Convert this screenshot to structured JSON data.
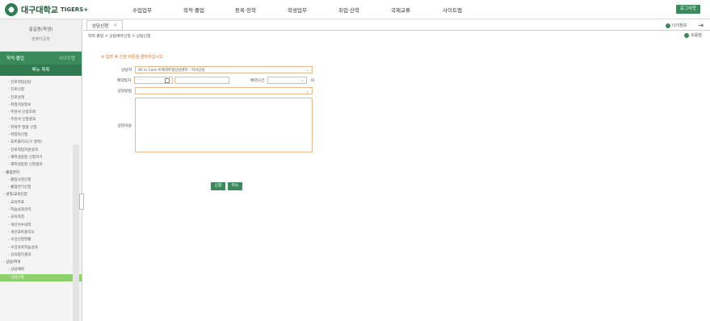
{
  "header": {
    "logo_text": "대구대학교",
    "logo_sub": "TIGERS+",
    "nav": [
      "수업업무",
      "학적·졸업",
      "등록·장학",
      "학생업무",
      "취업·산학",
      "국제교류",
      "사이트맵"
    ],
    "logout": "로그아웃"
  },
  "sidebar": {
    "profile_name": "홍길동(학생)",
    "profile_dept": "컴퓨터공학",
    "menu_head": "학적·졸업",
    "menu_head_right": "사이트맵",
    "menu_sub": "메뉴 목록",
    "items": [
      {
        "label": "- 진로취업상담",
        "group": false
      },
      {
        "label": "- 진로신청",
        "group": false
      },
      {
        "label": "- 진로설계",
        "group": false
      },
      {
        "label": "- 취업지원정보",
        "group": false
      },
      {
        "label": "- 추천서 신청조회",
        "group": false
      },
      {
        "label": "- 추천서 신청결과",
        "group": false
      },
      {
        "label": "- 학적부 열람 신청",
        "group": false
      },
      {
        "label": "- 취업자신청",
        "group": false
      },
      {
        "label": "- 포트폴리오(구 경력)",
        "group": false
      },
      {
        "label": "- 진로취업지원실적",
        "group": false
      },
      {
        "label": "- 재학생종합 신청하기",
        "group": false
      },
      {
        "label": "- 재학생종합 신청결과",
        "group": false
      },
      {
        "label": "- 졸업관리",
        "group": true
      },
      {
        "label": "- 졸업사정신청",
        "group": false
      },
      {
        "label": "- 졸업연기신청",
        "group": false
      },
      {
        "label": "- 성적/교육인증",
        "group": true
      },
      {
        "label": "- 교육목표",
        "group": false
      },
      {
        "label": "- 학습성과관리",
        "group": false
      },
      {
        "label": "- 교육과정",
        "group": false
      },
      {
        "label": "- 개인이수내역",
        "group": false
      },
      {
        "label": "- 개인포트폴리오",
        "group": false
      },
      {
        "label": "- 수강신청현황",
        "group": false
      },
      {
        "label": "- 수강과목학습성과",
        "group": false
      },
      {
        "label": "- 강의평가결과",
        "group": false
      },
      {
        "label": "- 상담/학적",
        "group": true
      },
      {
        "label": "- 상담예약",
        "group": false
      },
      {
        "label": "- 상담신청",
        "group": false
      }
    ],
    "active_index": 26
  },
  "main": {
    "tab_label": "상담신청",
    "top_right_label": "나의정보",
    "breadcrumb": "학적·졸업 > 상담예약신청 > 상담신청",
    "help_label": "도움말",
    "notice": "※ 입력 후 신청 버튼을 클릭하십시오.",
    "form": {
      "counselor_label": "상담처",
      "counselor_value": "All in Care 이해대학생상담센터 - 학사상담",
      "date_label": "예약일자",
      "date_placeholder": "- - -",
      "time_label": "예약시간",
      "time_unit": "시",
      "type_label": "상담방법",
      "content_label": "상담내용"
    },
    "buttons": {
      "apply": "신청",
      "cancel": "취소"
    }
  },
  "colors": {
    "accent": "#3a8a5c",
    "active_menu": "#8dcf6b",
    "field_border": "#e9b98c",
    "notice": "#e07020"
  }
}
